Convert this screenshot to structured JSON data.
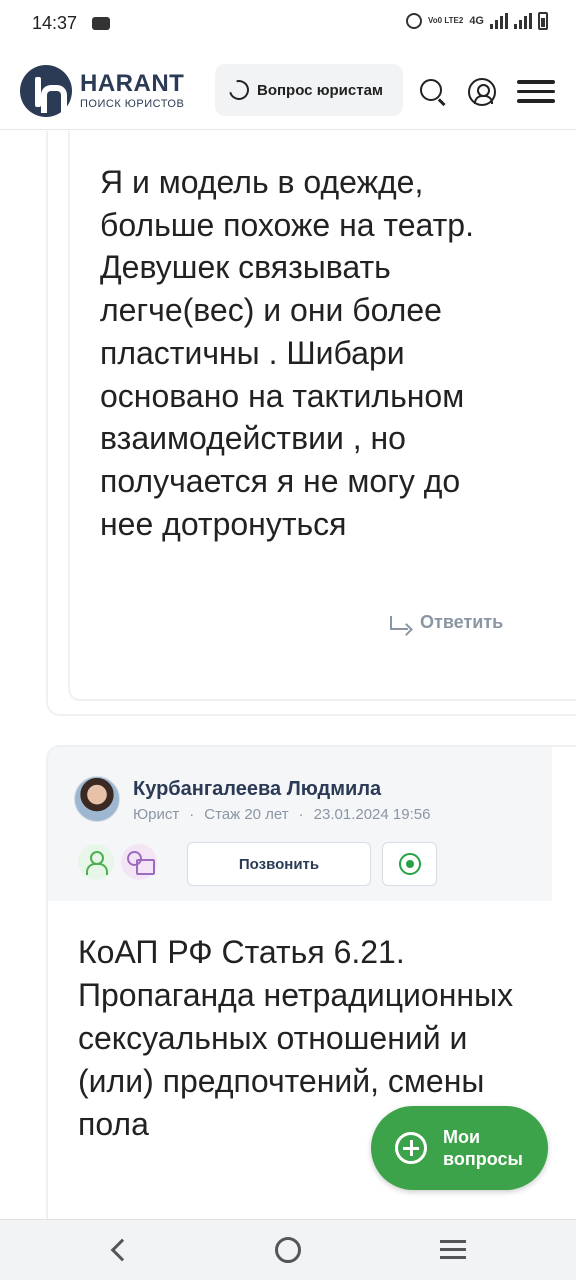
{
  "status_bar": {
    "time": "14:37",
    "network": "4G",
    "volte": "Vo0 LTE2"
  },
  "header": {
    "logo_name": "HARANT",
    "logo_subtitle": "ПОИСК ЮРИСТОВ",
    "ask_button_label": "Вопрос юристам",
    "icons": [
      "search-icon",
      "profile-icon",
      "menu-icon"
    ]
  },
  "comment": {
    "text": "Я и модель в одежде, больше похоже на театр. Девушек связывать легче(вес) и они более пластичны . Шибари основано на тактильном взаимодействии , но получается я не могу до нее дотронуться",
    "reply_label": "Ответить"
  },
  "answer": {
    "author_name": "Курбангалеева Людмила",
    "role": "Юрист",
    "experience": "Стаж 20 лет",
    "datetime": "23.01.2024 19:56",
    "call_button_label": "Позвонить",
    "text": "КоАП РФ Статья 6.21. Пропаганда нетрадиционных сексуальных отношений и (или) предпочтений, смены пола"
  },
  "fab": {
    "label": "Мои вопросы"
  },
  "colors": {
    "brand_navy": "#2b3a55",
    "accent_green": "#3ca34a",
    "muted_gray": "#8a96a3"
  }
}
